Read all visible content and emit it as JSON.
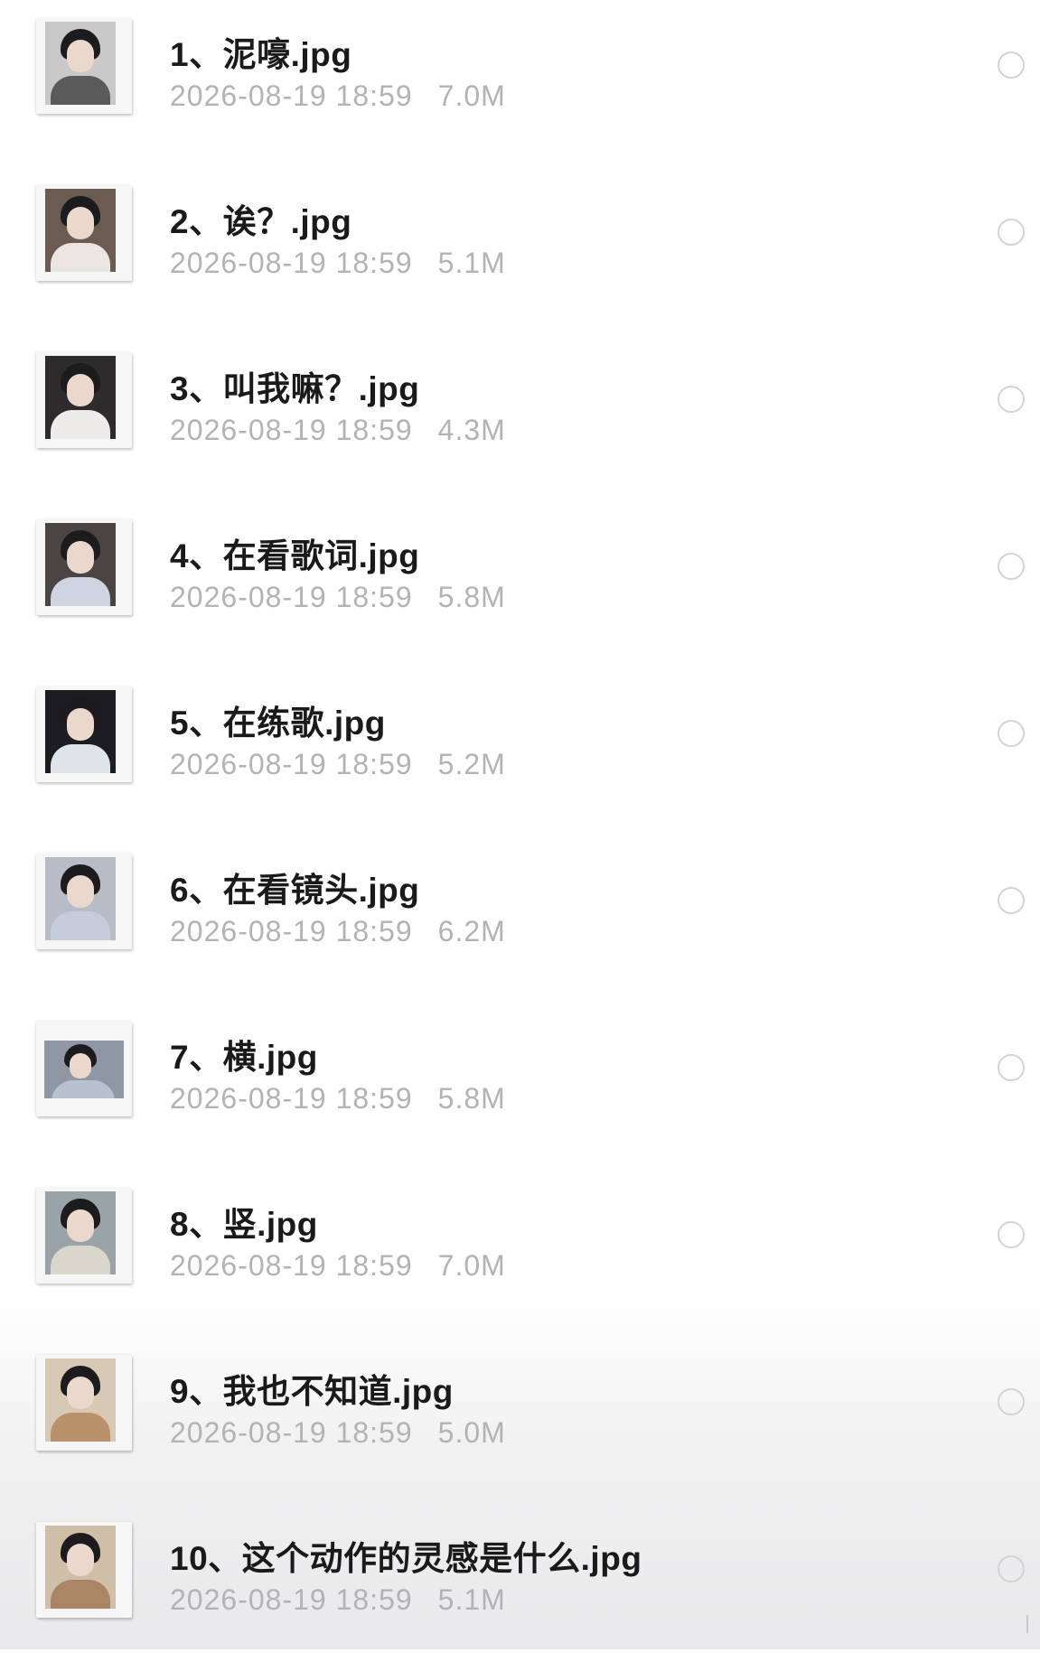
{
  "files": [
    {
      "name": "1、泥嚎.jpg",
      "date": "2026-08-19 18:59",
      "size": "7.0M",
      "thumb_bg": "#c9c9c9",
      "thumb_body": "#5a5a5a"
    },
    {
      "name": "2、诶？.jpg",
      "date": "2026-08-19 18:59",
      "size": "5.1M",
      "thumb_bg": "#6b5b52",
      "thumb_body": "#e9e6e2"
    },
    {
      "name": "3、叫我嘛？.jpg",
      "date": "2026-08-19 18:59",
      "size": "4.3M",
      "thumb_bg": "#2d2b2b",
      "thumb_body": "#eeeceb"
    },
    {
      "name": "4、在看歌词.jpg",
      "date": "2026-08-19 18:59",
      "size": "5.8M",
      "thumb_bg": "#4a4442",
      "thumb_body": "#cfd5e0"
    },
    {
      "name": "5、在练歌.jpg",
      "date": "2026-08-19 18:59",
      "size": "5.2M",
      "thumb_bg": "#1c1c22",
      "thumb_body": "#dfe3ea"
    },
    {
      "name": "6、在看镜头.jpg",
      "date": "2026-08-19 18:59",
      "size": "6.2M",
      "thumb_bg": "#b7bcc6",
      "thumb_body": "#c6ccdb"
    },
    {
      "name": "7、横.jpg",
      "date": "2026-08-19 18:59",
      "size": "5.8M",
      "thumb_bg": "#8e97a3",
      "thumb_body": "#b8c1d0"
    },
    {
      "name": "8、竖.jpg",
      "date": "2026-08-19 18:59",
      "size": "7.0M",
      "thumb_bg": "#9aa3a8",
      "thumb_body": "#d9d6cc"
    },
    {
      "name": "9、我也不知道.jpg",
      "date": "2026-08-19 18:59",
      "size": "5.0M",
      "thumb_bg": "#d8c9b4",
      "thumb_body": "#b9916a"
    },
    {
      "name": "10、这个动作的灵感是什么.jpg",
      "date": "2026-08-19 18:59",
      "size": "5.1M",
      "thumb_bg": "#cfbfa8",
      "thumb_body": "#a98565"
    }
  ],
  "icons": {
    "thumbnail": "photo-thumbnail-icon",
    "select": "selection-circle-icon"
  },
  "colors": {
    "name": "#1a1a1a",
    "meta": "#b3b3b7",
    "circle": "#d4d4d6"
  }
}
